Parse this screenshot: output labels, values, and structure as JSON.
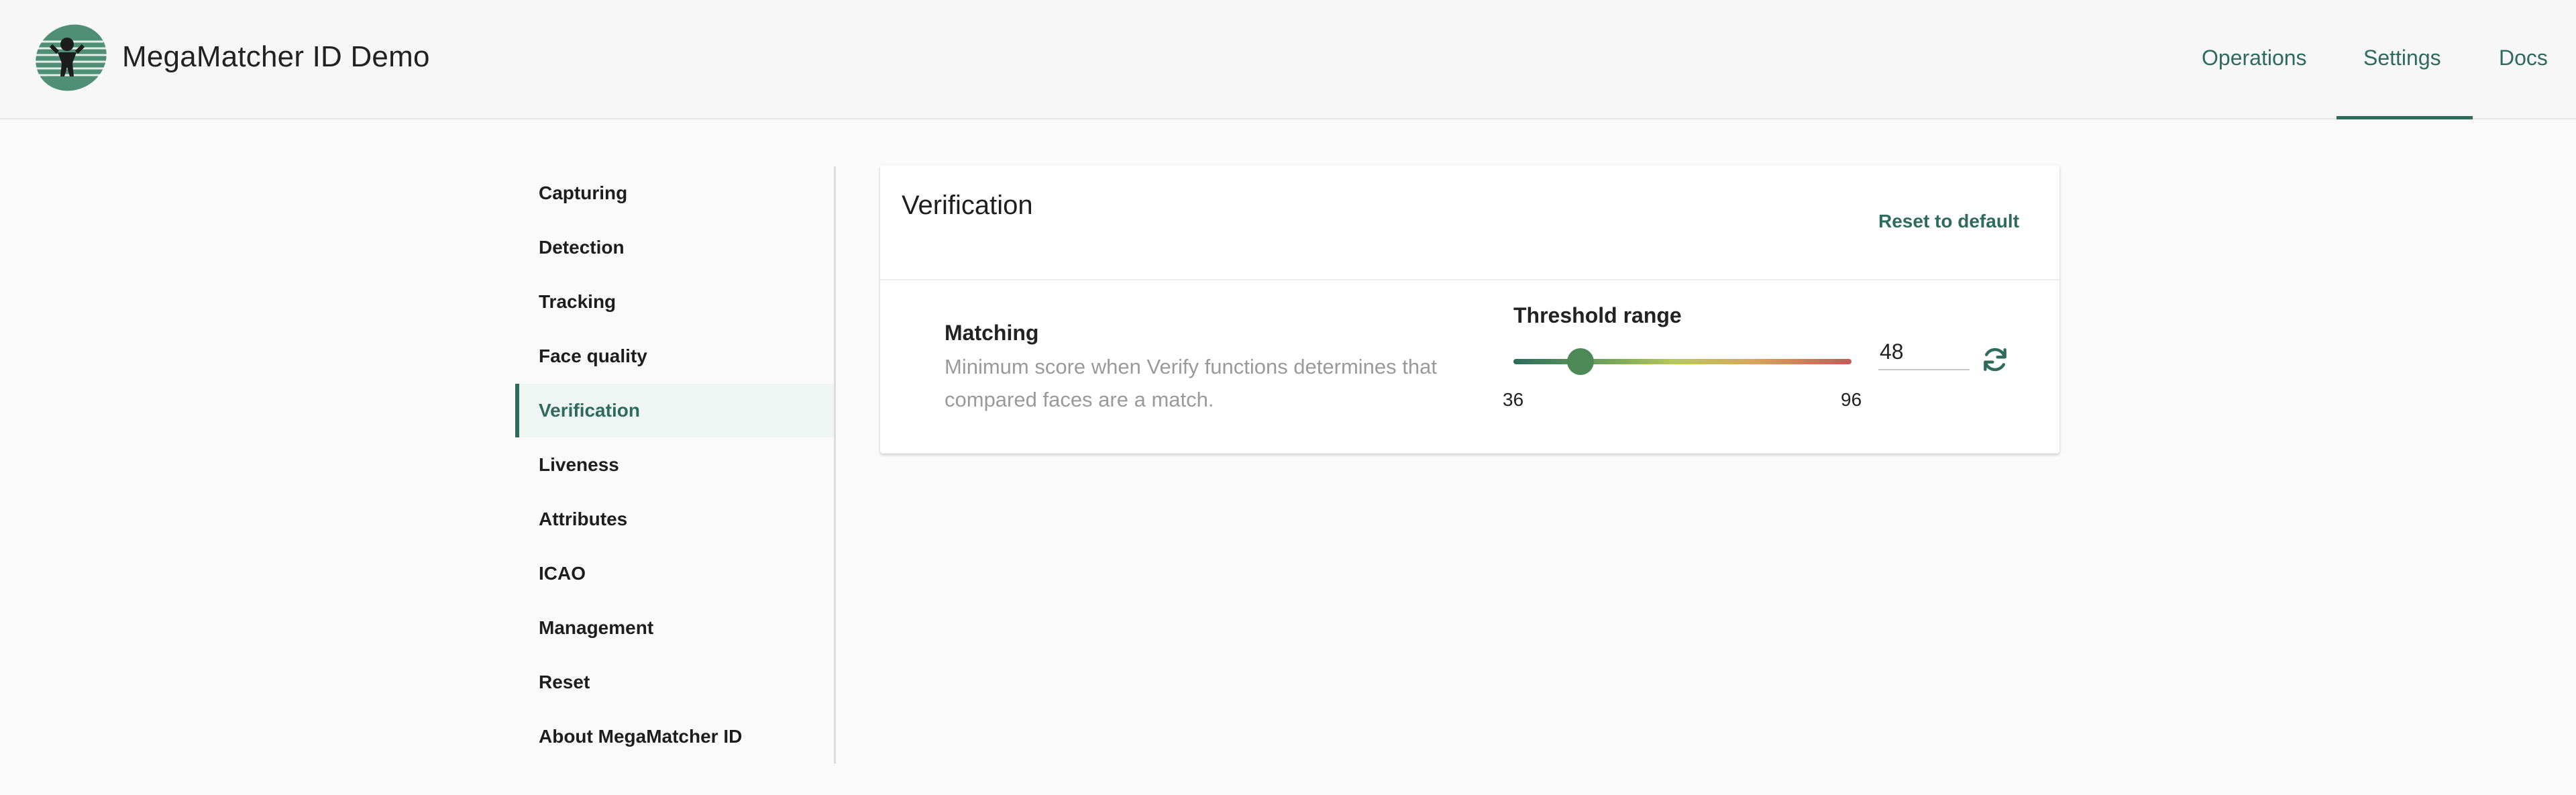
{
  "header": {
    "app_title": "MegaMatcher ID Demo",
    "nav": [
      {
        "label": "Operations"
      },
      {
        "label": "Settings"
      },
      {
        "label": "Docs"
      }
    ],
    "active_nav": "Settings"
  },
  "sidebar": {
    "items": [
      {
        "label": "Capturing"
      },
      {
        "label": "Detection"
      },
      {
        "label": "Tracking"
      },
      {
        "label": "Face quality"
      },
      {
        "label": "Verification"
      },
      {
        "label": "Liveness"
      },
      {
        "label": "Attributes"
      },
      {
        "label": "ICAO"
      },
      {
        "label": "Management"
      },
      {
        "label": "Reset"
      },
      {
        "label": "About MegaMatcher ID"
      }
    ],
    "active_item": "Verification"
  },
  "card": {
    "title": "Verification",
    "reset_label": "Reset to default",
    "setting": {
      "name": "Matching",
      "description": "Minimum score when Verify functions determines that compared faces are a match.",
      "threshold_label": "Threshold range",
      "min": "36",
      "max": "96",
      "value": "48"
    }
  },
  "colors": {
    "accent": "#2e6b5b",
    "slider_start": "#2e6b5b",
    "slider_mid": "#b9c95a",
    "slider_end": "#c8585a"
  },
  "icons": {
    "logo": "megamatcher-logo",
    "refresh": "refresh-icon"
  }
}
